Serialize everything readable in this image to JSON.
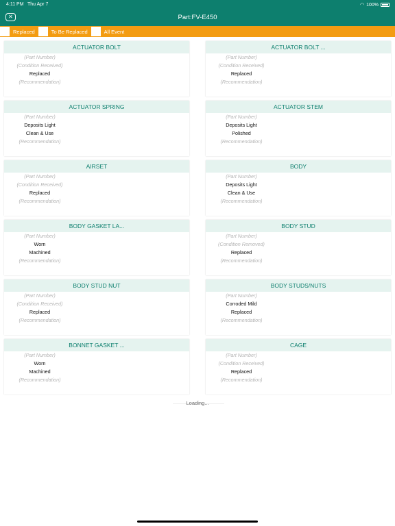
{
  "status": {
    "time": "4:11 PM",
    "date": "Thu Apr 7",
    "battery": "100%"
  },
  "header": {
    "title": "Part:FV-E450"
  },
  "filters": [
    {
      "label": "Replaced"
    },
    {
      "label": "To Be Replaced"
    },
    {
      "label": "All Event"
    }
  ],
  "cards": [
    {
      "title": "ACTUATOR BOLT",
      "lines": [
        {
          "text": "(Part Number)",
          "kind": "ph"
        },
        {
          "text": "(Condition Received)",
          "kind": "ph"
        },
        {
          "text": "Replaced",
          "kind": "val"
        },
        {
          "text": "(Recommendation)",
          "kind": "ph"
        }
      ]
    },
    {
      "title": "ACTUATOR BOLT ...",
      "lines": [
        {
          "text": "(Part Number)",
          "kind": "ph"
        },
        {
          "text": "(Condition Received)",
          "kind": "ph"
        },
        {
          "text": "Replaced",
          "kind": "val"
        },
        {
          "text": "(Recommendation)",
          "kind": "ph"
        }
      ]
    },
    {
      "title": "ACTUATOR SPRING",
      "lines": [
        {
          "text": "(Part Number)",
          "kind": "ph"
        },
        {
          "text": "Deposits Light",
          "kind": "val"
        },
        {
          "text": "Clean & Use",
          "kind": "val"
        },
        {
          "text": "(Recommendation)",
          "kind": "ph"
        }
      ]
    },
    {
      "title": "ACTUATOR STEM",
      "lines": [
        {
          "text": "(Part Number)",
          "kind": "ph"
        },
        {
          "text": "Deposits Light",
          "kind": "val"
        },
        {
          "text": "Polished",
          "kind": "val"
        },
        {
          "text": "(Recommendation)",
          "kind": "ph"
        }
      ]
    },
    {
      "title": "AIRSET",
      "lines": [
        {
          "text": "(Part Number)",
          "kind": "ph"
        },
        {
          "text": "(Condition Received)",
          "kind": "ph"
        },
        {
          "text": "Replaced",
          "kind": "val"
        },
        {
          "text": "(Recommendation)",
          "kind": "ph"
        }
      ]
    },
    {
      "title": "BODY",
      "lines": [
        {
          "text": "(Part Number)",
          "kind": "ph"
        },
        {
          "text": "Deposits Light",
          "kind": "val"
        },
        {
          "text": "Clean & Use",
          "kind": "val"
        },
        {
          "text": "(Recommendation)",
          "kind": "ph"
        }
      ]
    },
    {
      "title": "BODY GASKET LA...",
      "lines": [
        {
          "text": "(Part Number)",
          "kind": "ph"
        },
        {
          "text": "Worn",
          "kind": "val"
        },
        {
          "text": "Machined",
          "kind": "val"
        },
        {
          "text": "(Recommendation)",
          "kind": "ph"
        }
      ]
    },
    {
      "title": "BODY STUD",
      "lines": [
        {
          "text": "(Part Number)",
          "kind": "ph"
        },
        {
          "text": "(Condition Removed)",
          "kind": "ph"
        },
        {
          "text": "Replaced",
          "kind": "val"
        },
        {
          "text": "(Recommendation)",
          "kind": "ph"
        }
      ]
    },
    {
      "title": "BODY STUD NUT",
      "lines": [
        {
          "text": "(Part Number)",
          "kind": "ph"
        },
        {
          "text": "(Condition Received)",
          "kind": "ph"
        },
        {
          "text": "Replaced",
          "kind": "val"
        },
        {
          "text": "(Recommendation)",
          "kind": "ph"
        }
      ]
    },
    {
      "title": "BODY STUDS/NUTS",
      "lines": [
        {
          "text": "(Part Number)",
          "kind": "ph"
        },
        {
          "text": "Corroded Mild",
          "kind": "val"
        },
        {
          "text": "Replaced",
          "kind": "val"
        },
        {
          "text": "(Recommendation)",
          "kind": "ph"
        }
      ]
    },
    {
      "title": "BONNET GASKET ...",
      "lines": [
        {
          "text": "(Part Number)",
          "kind": "ph"
        },
        {
          "text": "Worn",
          "kind": "val"
        },
        {
          "text": "Machined",
          "kind": "val"
        },
        {
          "text": "(Recommendation)",
          "kind": "ph"
        }
      ]
    },
    {
      "title": "CAGE",
      "lines": [
        {
          "text": "(Part Number)",
          "kind": "ph"
        },
        {
          "text": "(Condition Received)",
          "kind": "ph"
        },
        {
          "text": "Replaced",
          "kind": "val"
        },
        {
          "text": "(Recommendation)",
          "kind": "ph"
        }
      ]
    }
  ],
  "loading": "Loading..."
}
